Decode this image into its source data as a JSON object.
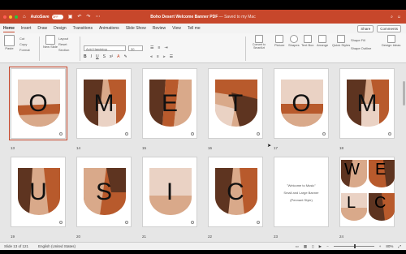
{
  "titlebar": {
    "autosave_label": "AutoSave",
    "autosave_state": "OFF",
    "doc_name": "Boho Desert Welcome Banner PDF",
    "saved_status": "— Saved to my Mac"
  },
  "tabs": [
    "Home",
    "Insert",
    "Draw",
    "Design",
    "Transitions",
    "Animations",
    "Slide Show",
    "Review",
    "View",
    "Tell me"
  ],
  "tab_right": {
    "share": "Share",
    "comments": "Comments"
  },
  "ribbon": {
    "paste": "Paste",
    "cut": "Cut",
    "copy": "Copy",
    "format": "Format",
    "new_slide": "New Slide",
    "layout": "Layout",
    "reset": "Reset",
    "section": "Section",
    "font": "Avid Handstop",
    "size": "30",
    "convert_smartart": "Convert to SmartArt",
    "picture": "Picture",
    "shapes": "Shapes",
    "text_box": "Text Box",
    "arrange": "Arrange",
    "quick_styles": "Quick Styles",
    "shape_fill": "Shape Fill",
    "shape_outline": "Shape Outline",
    "design_ideas": "Design Ideas"
  },
  "slides": [
    {
      "num": "13",
      "letter": "O"
    },
    {
      "num": "14",
      "letter": "M"
    },
    {
      "num": "15",
      "letter": "E"
    },
    {
      "num": "16",
      "letter": "T"
    },
    {
      "num": "17",
      "letter": "O"
    },
    {
      "num": "18",
      "letter": "M"
    },
    {
      "num": "19",
      "letter": "U"
    },
    {
      "num": "20",
      "letter": "S"
    },
    {
      "num": "21",
      "letter": "I"
    },
    {
      "num": "22",
      "letter": "C"
    },
    {
      "num": "23",
      "letter": ""
    },
    {
      "num": "24",
      "letter": ""
    }
  ],
  "text_slide": {
    "line1": "\"Welcome to Music\"",
    "line2": "Small and Large Banner",
    "line3": "(Pennant Style)"
  },
  "slide24_letters": [
    "W",
    "E",
    "L",
    "C"
  ],
  "statusbar": {
    "slide_info": "Slide 13 of 121",
    "language": "English (United States)",
    "zoom": "80%"
  },
  "colors": {
    "accent": "#c7472b",
    "dark_brown": "#5e3420",
    "rust": "#b85a2c",
    "tan": "#d9a98a",
    "blush": "#ead2c4"
  }
}
